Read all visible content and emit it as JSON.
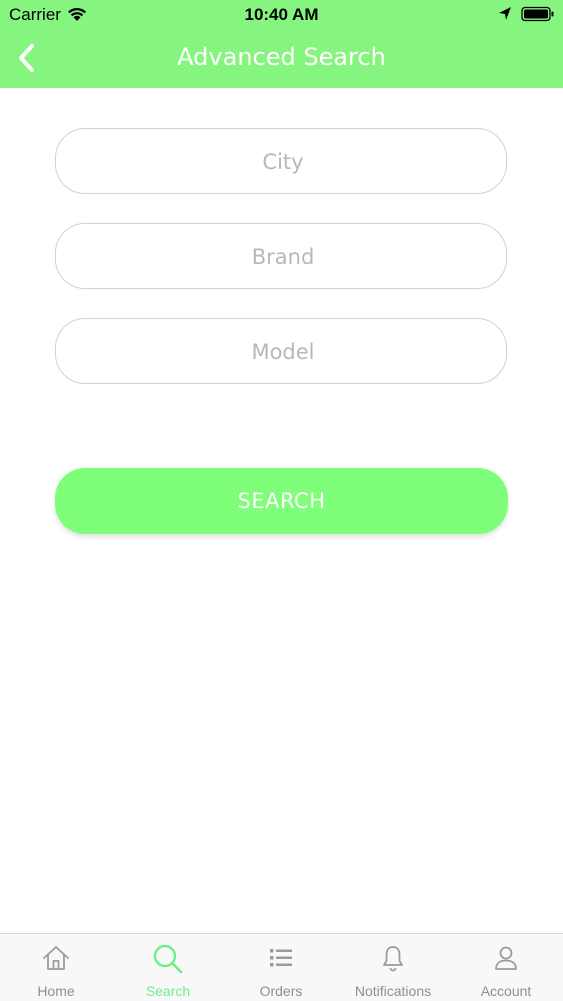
{
  "status_bar": {
    "carrier": "Carrier",
    "time": "10:40 AM"
  },
  "nav": {
    "title": "Advanced Search",
    "back_icon": "chevron-left-icon"
  },
  "form": {
    "city_placeholder": "City",
    "brand_placeholder": "Brand",
    "model_placeholder": "Model",
    "search_label": "SEARCH"
  },
  "tabs": [
    {
      "label": "Home",
      "icon": "home-icon",
      "active": false
    },
    {
      "label": "Search",
      "icon": "search-icon",
      "active": true
    },
    {
      "label": "Orders",
      "icon": "list-icon",
      "active": false
    },
    {
      "label": "Notifications",
      "icon": "bell-icon",
      "active": false
    },
    {
      "label": "Account",
      "icon": "user-icon",
      "active": false
    }
  ],
  "colors": {
    "header": "#86f57f",
    "button": "#7ffe79",
    "active_tab": "#6cf08a",
    "inactive_tab": "#8e8e8e"
  }
}
